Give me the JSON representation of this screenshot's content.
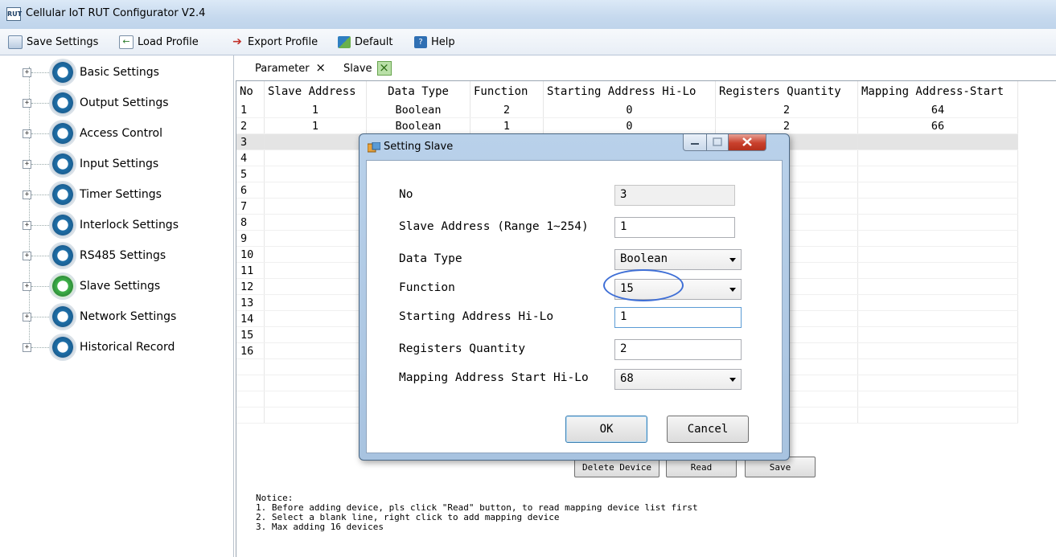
{
  "app": {
    "title": "Cellular IoT RUT Configurator V2.4",
    "icon_text": "RUT"
  },
  "menu": [
    {
      "label": "Save Settings",
      "icon": "save-icon"
    },
    {
      "label": "Load Profile",
      "icon": "load-icon"
    },
    {
      "label": "Export Profile",
      "icon": "export-icon"
    },
    {
      "label": "Default",
      "icon": "default-icon"
    },
    {
      "label": "Help",
      "icon": "help-icon"
    }
  ],
  "sidebar": {
    "items": [
      {
        "label": "Basic Settings",
        "expander": "+"
      },
      {
        "label": "Output Settings",
        "expander": "+"
      },
      {
        "label": "Access Control",
        "expander": "+"
      },
      {
        "label": "Input Settings",
        "expander": "+"
      },
      {
        "label": "Timer Settings",
        "expander": "+"
      },
      {
        "label": "Interlock Settings",
        "expander": "+"
      },
      {
        "label": "RS485 Settings",
        "expander": "+"
      },
      {
        "label": "Slave Settings",
        "expander": "+"
      },
      {
        "label": "Network Settings",
        "expander": "+"
      },
      {
        "label": "Historical Record",
        "expander": "+"
      }
    ]
  },
  "tabs": [
    {
      "label": "Parameter",
      "close": "×"
    },
    {
      "label": "Slave",
      "close": "×"
    }
  ],
  "table": {
    "columns": [
      "No",
      "Slave Address",
      "Data Type",
      "Function",
      "Starting Address Hi-Lo",
      "Registers Quantity",
      "Mapping Address-Start"
    ],
    "rows": [
      [
        "1",
        "1",
        "Boolean",
        "2",
        "0",
        "2",
        "64"
      ],
      [
        "2",
        "1",
        "Boolean",
        "1",
        "0",
        "2",
        "66"
      ],
      [
        "3",
        "",
        "",
        "",
        "",
        "",
        ""
      ],
      [
        "4",
        "",
        "",
        "",
        "",
        "",
        ""
      ],
      [
        "5",
        "",
        "",
        "",
        "",
        "",
        ""
      ],
      [
        "6",
        "",
        "",
        "",
        "",
        "",
        ""
      ],
      [
        "7",
        "",
        "",
        "",
        "",
        "",
        ""
      ],
      [
        "8",
        "",
        "",
        "",
        "",
        "",
        ""
      ],
      [
        "9",
        "",
        "",
        "",
        "",
        "",
        ""
      ],
      [
        "10",
        "",
        "",
        "",
        "",
        "",
        ""
      ],
      [
        "11",
        "",
        "",
        "",
        "",
        "",
        ""
      ],
      [
        "12",
        "",
        "",
        "",
        "",
        "",
        ""
      ],
      [
        "13",
        "",
        "",
        "",
        "",
        "",
        ""
      ],
      [
        "14",
        "",
        "",
        "",
        "",
        "",
        ""
      ],
      [
        "15",
        "",
        "",
        "",
        "",
        "",
        ""
      ],
      [
        "16",
        "",
        "",
        "",
        "",
        "",
        ""
      ]
    ]
  },
  "actions": {
    "delete": "Delete Device",
    "read": "Read",
    "save": "Save"
  },
  "notice": "Notice:\n1. Before adding device, pls click \"Read\" button, to read mapping device list first\n2. Select a blank line, right click to add mapping device\n3. Max adding 16 devices",
  "dialog": {
    "title": "Setting Slave",
    "fields": {
      "no_label": "No",
      "no_value": "3",
      "slave_label": "Slave Address (Range 1~254)",
      "slave_value": "1",
      "type_label": "Data Type",
      "type_value": "Boolean",
      "function_label": "Function",
      "function_value": "15",
      "start_label": "Starting Address Hi-Lo",
      "start_value": "1",
      "qty_label": "Registers Quantity",
      "qty_value": "2",
      "map_label": "Mapping Address Start Hi-Lo",
      "map_value": "68"
    },
    "ok": "OK",
    "cancel": "Cancel"
  },
  "colors": {
    "title_bar": "#c6d9ee",
    "dialog_frame": "#a8c3e0",
    "annotation": "#3f6fd6",
    "selection": "#e4e4e4"
  }
}
